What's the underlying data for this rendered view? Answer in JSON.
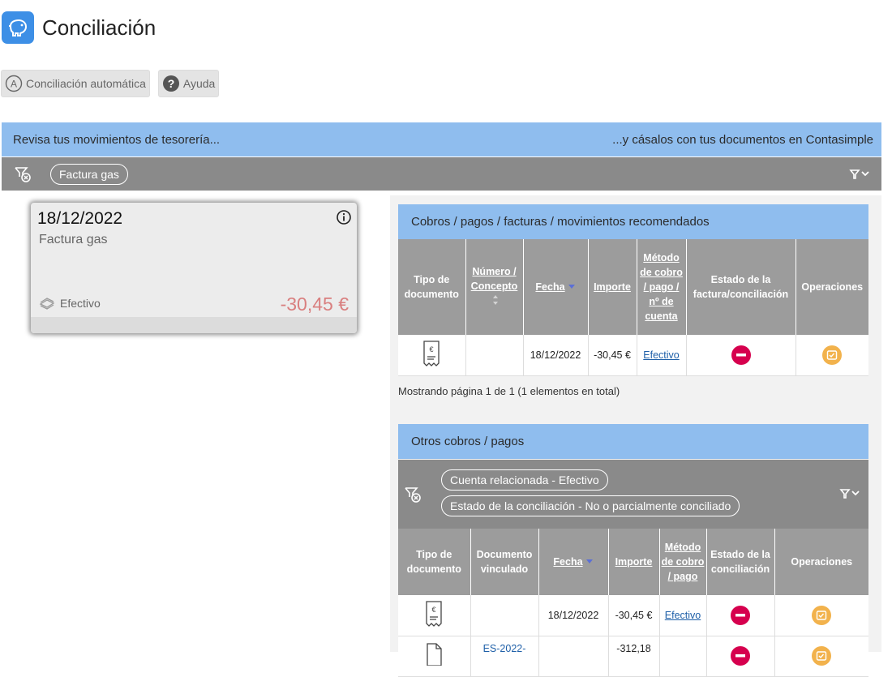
{
  "page": {
    "title": "Conciliación",
    "icon": "piggy-bank-icon",
    "accent": "#3d8fe6"
  },
  "toolbar": {
    "auto_label": "Conciliación automática",
    "help_label": "Ayuda"
  },
  "banner": {
    "left": "Revisa tus movimientos de tesorería...",
    "right": "...y cásalos con tus documentos en Contasimple"
  },
  "filter": {
    "chip": "Factura gas"
  },
  "movement": {
    "date": "18/12/2022",
    "concept": "Factura gas",
    "method": "Efectivo",
    "amount": "-30,45 €"
  },
  "recommended": {
    "title": "Cobros / pagos / facturas / movimientos recomendados",
    "headers": {
      "tipo": "Tipo de documento",
      "numero": "Número / Concepto",
      "fecha": "Fecha",
      "importe": "Importe",
      "metodo": "Método de cobro / pago / nº de cuenta",
      "estado": "Estado de la factura/conciliación",
      "operaciones": "Operaciones"
    },
    "rows": [
      {
        "numero": "",
        "fecha": "18/12/2022",
        "importe": "-30,45 €",
        "metodo": "Efectivo"
      }
    ],
    "pager": "Mostrando página 1 de 1 (1 elementos en total)"
  },
  "others": {
    "title": "Otros cobros / pagos",
    "chips": [
      "Cuenta relacionada - Efectivo",
      "Estado de la conciliación - No o parcialmente conciliado"
    ],
    "headers": {
      "tipo": "Tipo de documento",
      "documento": "Documento vinculado",
      "fecha": "Fecha",
      "importe": "Importe",
      "metodo": "Método de cobro / pago",
      "estado": "Estado de la conciliación",
      "operaciones": "Operaciones"
    },
    "rows": [
      {
        "documento": "",
        "fecha": "18/12/2022",
        "importe": "-30,45 €",
        "metodo": "Efectivo"
      },
      {
        "documento": "ES-2022-",
        "fecha": "",
        "importe": "-312,18",
        "metodo": ""
      }
    ]
  }
}
